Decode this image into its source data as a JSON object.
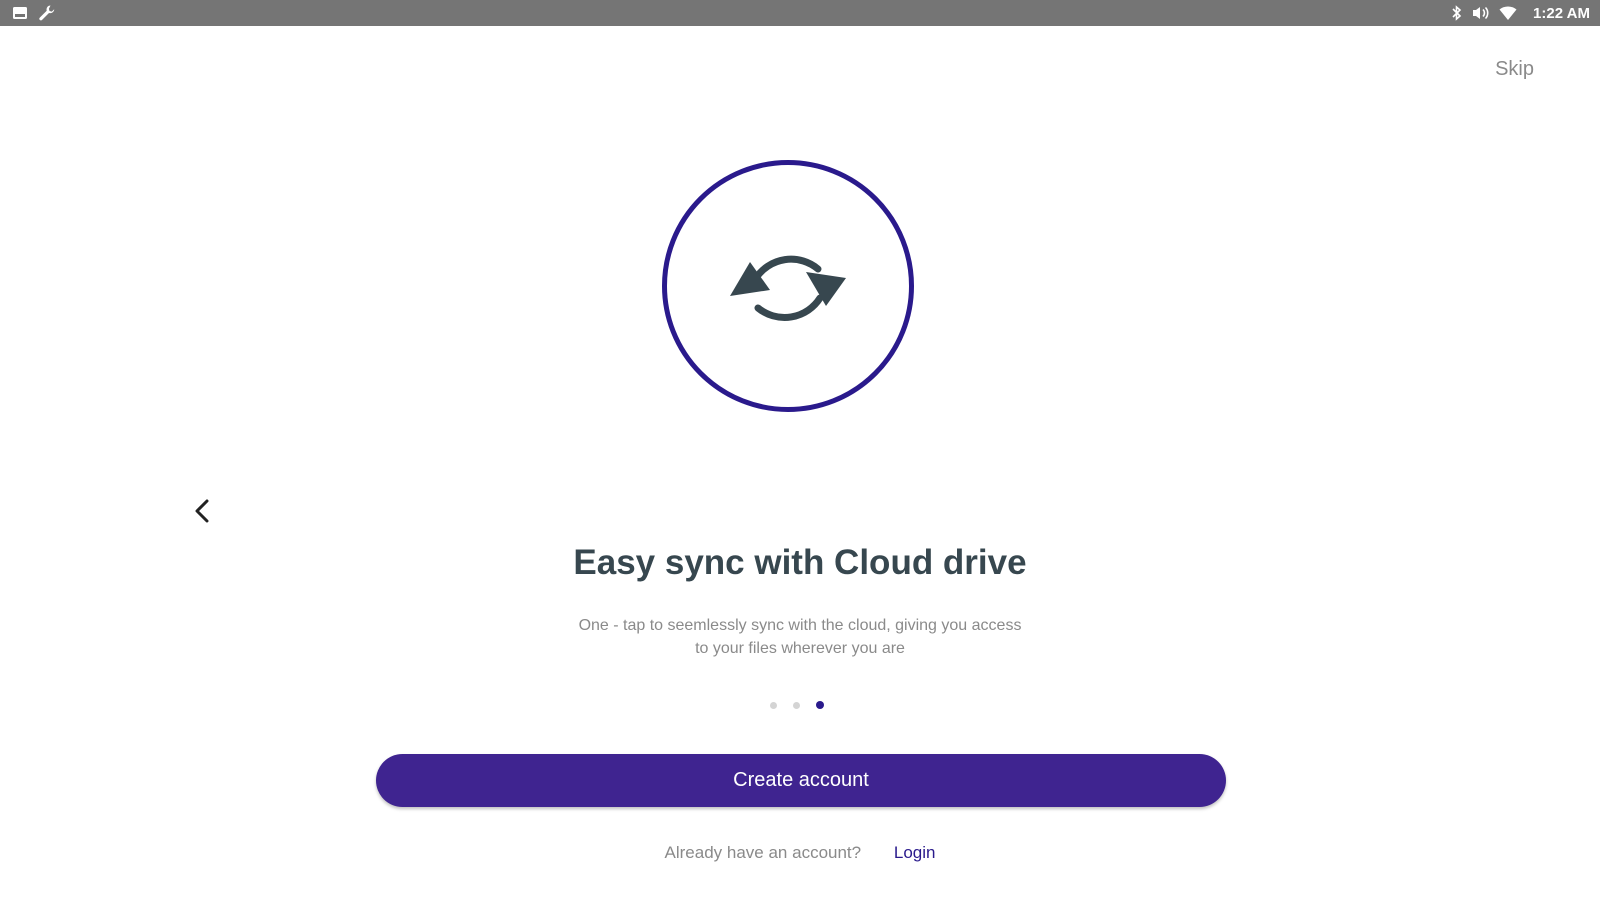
{
  "status_bar": {
    "left_icons": [
      "image-icon",
      "wrench-icon"
    ],
    "right_icons": [
      "bluetooth-icon",
      "volume-icon",
      "wifi-icon"
    ],
    "time": "1:22 AM"
  },
  "header": {
    "skip_label": "Skip"
  },
  "hero": {
    "icon": "sync-icon"
  },
  "content": {
    "title": "Easy sync with Cloud drive",
    "subtitle_line1": "One - tap to seemlessly sync with the cloud, giving you access",
    "subtitle_line2": "to your files wherever you are"
  },
  "pager": {
    "total": 3,
    "current": 3
  },
  "actions": {
    "create_account_label": "Create account",
    "login_prompt": "Already have an account?",
    "login_label": "Login"
  },
  "colors": {
    "accent": "#3f2490",
    "circle_border": "#2a1a8c",
    "title_text": "#37474f",
    "muted_text": "#8a8a8a",
    "status_bar": "#757575"
  }
}
